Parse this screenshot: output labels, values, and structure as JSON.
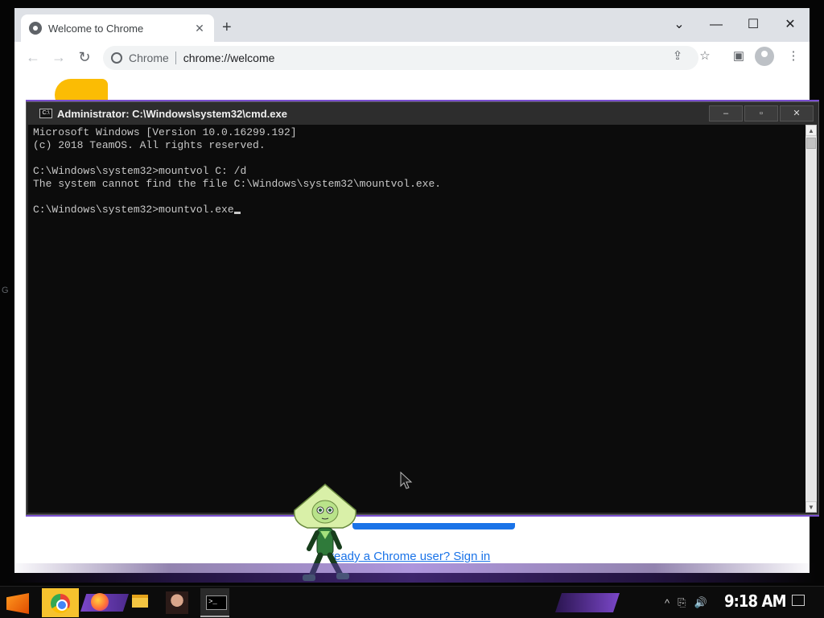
{
  "chrome": {
    "tab_title": "Welcome to Chrome",
    "tab_close": "✕",
    "new_tab": "+",
    "window_controls": {
      "dropdown": "⌄",
      "minimize": "—",
      "maximize": "☐",
      "close": "✕"
    },
    "nav": {
      "back": "←",
      "forward": "→",
      "reload": "↻"
    },
    "omnibox": {
      "site_name": "Chrome",
      "url": "chrome://welcome"
    },
    "toolbar_icons": [
      "share-icon",
      "star-icon",
      "side-panel-icon",
      "profile-icon",
      "menu-icon"
    ],
    "toolbar_glyphs": {
      "share": "⇪",
      "star": "☆",
      "side_panel": "▣",
      "menu": "⋮"
    },
    "content": {
      "signin_link": "ready a Chrome user? Sign in",
      "side_letter": "G"
    }
  },
  "cmd": {
    "title": "Administrator: C:\\Windows\\system32\\cmd.exe",
    "icon_text": "C:\\",
    "controls": {
      "minimize": "–",
      "maximize": "▫",
      "close": "✕"
    },
    "lines": [
      "Microsoft Windows [Version 10.0.16299.192]",
      "(c) 2018 TeamOS. All rights reserved.",
      "",
      "C:\\Windows\\system32>mountvol C: /d",
      "The system cannot find the file C:\\Windows\\system32\\mountvol.exe.",
      "",
      "C:\\Windows\\system32>mountvol.exe"
    ],
    "scroll": {
      "up": "▲",
      "down": "▼"
    }
  },
  "taskbar": {
    "apps": [
      "start-icon",
      "chrome-icon",
      "firefox-icon",
      "file-explorer-icon",
      "user-avatar-icon",
      "cmd-icon"
    ],
    "tray": {
      "chevron": "^",
      "network": "⎘",
      "volume": "🔊"
    },
    "clock": "9:18 AM"
  },
  "colors": {
    "accent_purple": "#7b47c9",
    "chrome_link": "#1a73e8",
    "taskbar_active": "#f6c22e"
  }
}
